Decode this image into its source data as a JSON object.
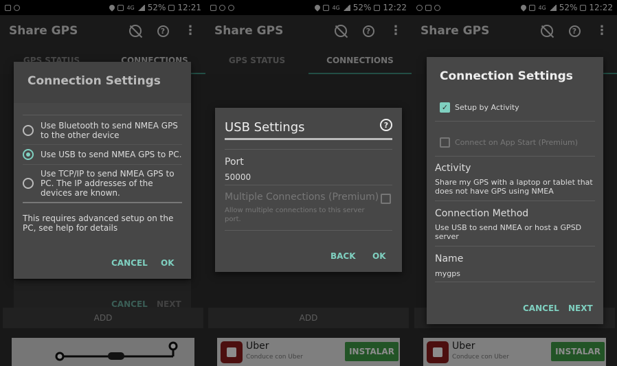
{
  "status_bar": {
    "left_screen1": "",
    "battery": "52%",
    "signal": "4G",
    "times": [
      "12:21",
      "12:22",
      "12:22"
    ]
  },
  "app": {
    "title": "Share GPS",
    "tabs": [
      "GPS STATUS",
      "CONNECTIONS"
    ]
  },
  "screen1": {
    "dialog_title": "Connection Settings",
    "options": [
      {
        "label": "Use Bluetooth to send NMEA GPS to the other device",
        "selected": false
      },
      {
        "label": "Use USB to send NMEA GPS to PC.",
        "selected": true
      },
      {
        "label": "Use TCP/IP to send NMEA GPS to PC. The IP addresses of the devices are known.",
        "selected": false
      }
    ],
    "note": "This requires advanced setup on the PC, see help for details",
    "cancel": "CANCEL",
    "ok": "OK",
    "behind_cancel": "CANCEL",
    "behind_next": "NEXT",
    "add": "ADD"
  },
  "screen2": {
    "dialog_title": "USB Settings",
    "port_label": "Port",
    "port_value": "50000",
    "multi_label": "Multiple Connections (Premium)",
    "multi_desc": "Allow multiple connections to this server port.",
    "back": "BACK",
    "ok": "OK",
    "add": "ADD",
    "ad_title": "Uber",
    "ad_sub": "Conduce con Uber",
    "ad_button": "INSTALAR"
  },
  "screen3": {
    "dialog_title": "Connection Settings",
    "setup_by_activity": "Setup by Activity",
    "connect_on_start": "Connect on App Start (Premium)",
    "activity_label": "Activity",
    "activity_desc": "Share my GPS with a laptop or tablet that does not have GPS using NMEA",
    "method_label": "Connection Method",
    "method_desc": "Use USB to send NMEA or host a GPSD server",
    "name_label": "Name",
    "name_value": "mygps",
    "cancel": "CANCEL",
    "next": "NEXT",
    "ad_title": "Uber",
    "ad_sub": "Conduce con Uber",
    "ad_button": "INSTALAR"
  },
  "colors": {
    "accent": "#7fd0c0",
    "ad_button": "#3f9a46",
    "ad_logo": "#8a1c1c"
  }
}
